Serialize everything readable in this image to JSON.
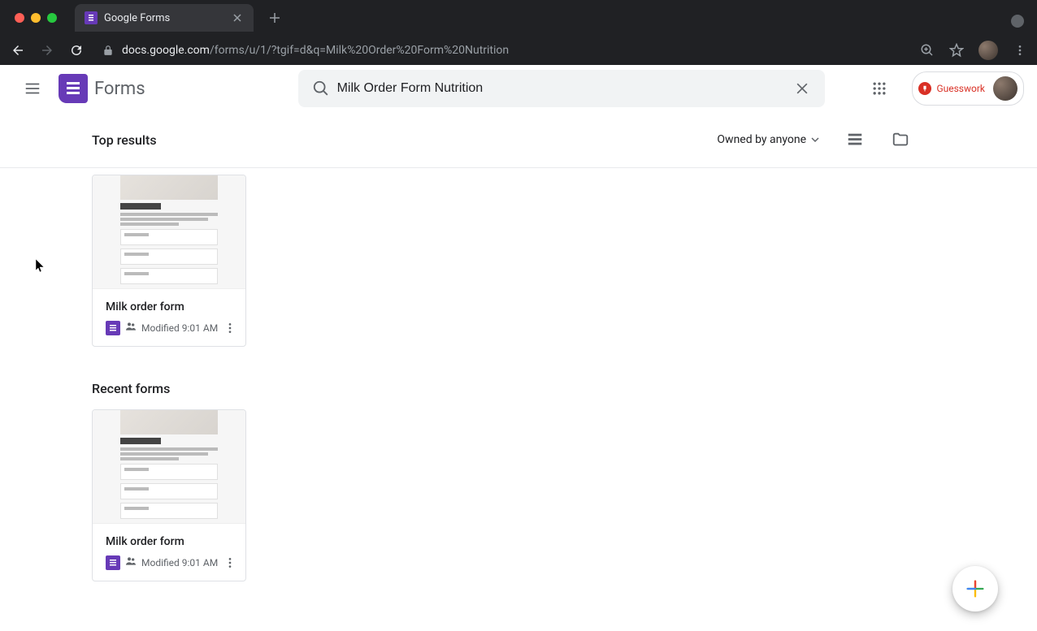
{
  "browser": {
    "tab_title": "Google Forms",
    "url_display_prefix": "docs.google.com",
    "url_display_path": "/forms/u/1/?tgif=d&q=Milk%20Order%20Form%20Nutrition"
  },
  "header": {
    "app_name": "Forms",
    "search_value": "Milk Order Form Nutrition",
    "extension_label": "Guesswork"
  },
  "filter": {
    "top_results_label": "Top results",
    "owned_label": "Owned by anyone"
  },
  "sections": {
    "recent_label": "Recent forms"
  },
  "cards": {
    "top": {
      "title": "Milk order form",
      "modified": "Modified 9:01 AM"
    },
    "recent": {
      "title": "Milk order form",
      "modified": "Modified 9:01 AM"
    }
  }
}
